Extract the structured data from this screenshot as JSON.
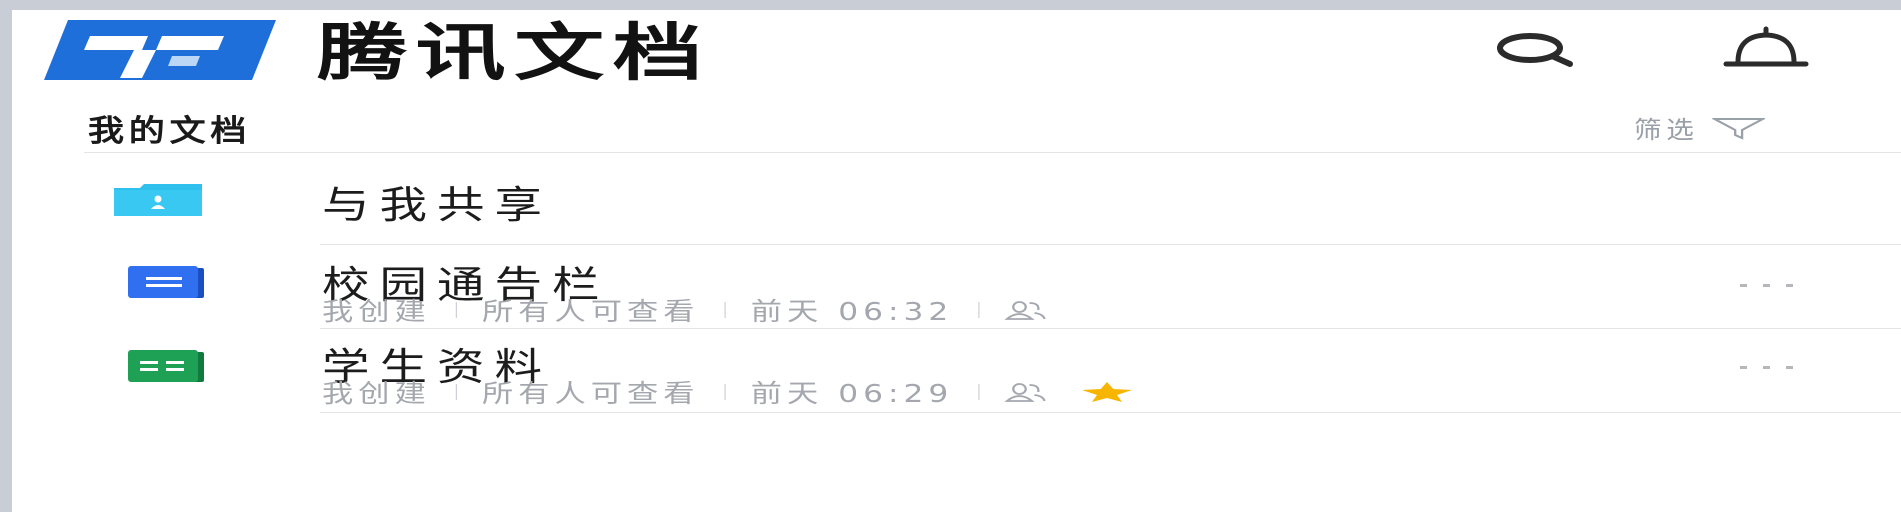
{
  "header": {
    "app_name": "腾讯文档",
    "logo_icon": "tencent-docs-logo",
    "search_icon": "search-icon",
    "notification_icon": "bell-icon"
  },
  "section": {
    "title": "我的文档",
    "filter_label": "筛选",
    "filter_icon": "funnel-icon"
  },
  "files": [
    {
      "type": "shared-folder",
      "icon": "shared-folder-icon",
      "title": "与我共享"
    },
    {
      "type": "doc",
      "icon": "doc-file-icon",
      "title": "校园通告栏",
      "meta": {
        "creator": "我创建",
        "permission": "所有人可查看",
        "time": "前天 06:32",
        "collab_icon": "people-icon"
      },
      "starred": false
    },
    {
      "type": "sheet",
      "icon": "sheet-file-icon",
      "title": "学生资料",
      "meta": {
        "creator": "我创建",
        "permission": "所有人可查看",
        "time": "前天 06:29",
        "collab_icon": "people-icon"
      },
      "starred": true
    }
  ],
  "colors": {
    "logo_blue": "#1e6fd9",
    "folder_blue": "#2fc0ee",
    "doc_blue": "#2f6ff0",
    "sheet_green": "#1fa155",
    "star_yellow": "#f7b500"
  }
}
